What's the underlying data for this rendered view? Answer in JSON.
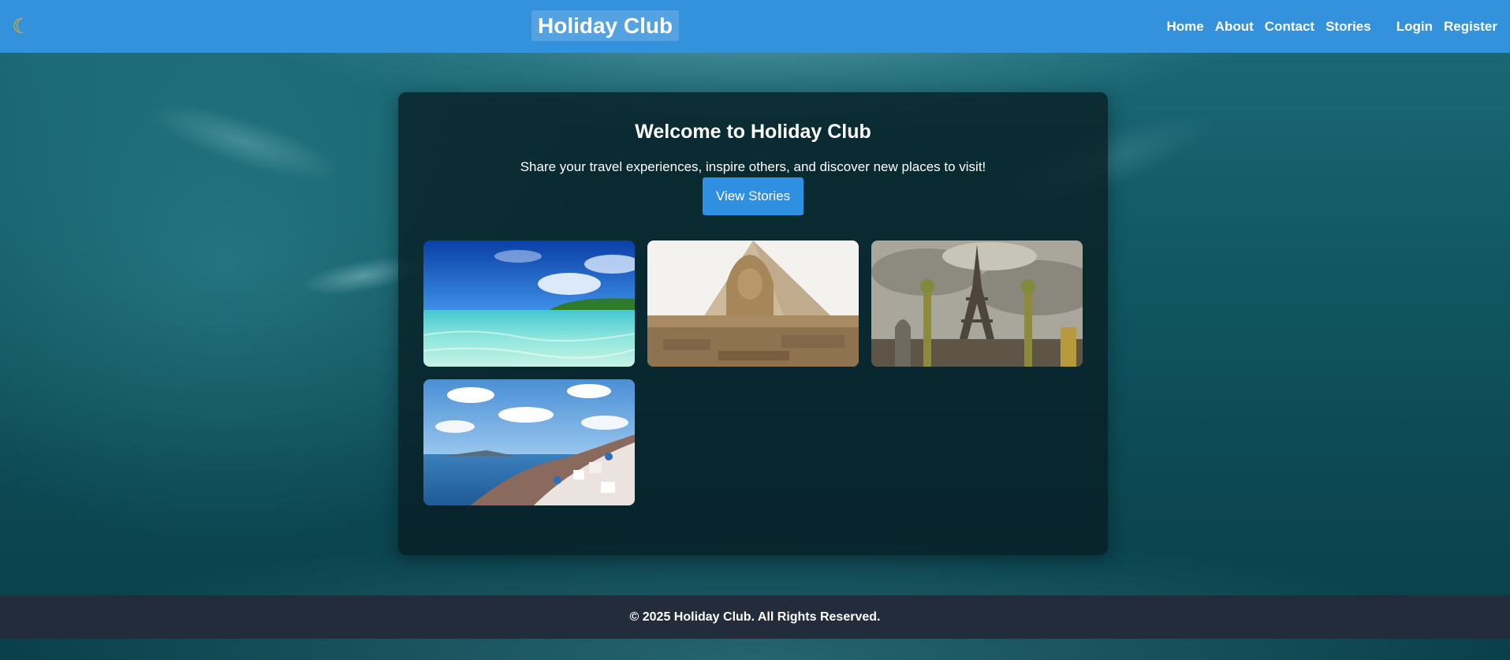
{
  "app": {
    "theme_icon": "moon-icon",
    "brand": "Holiday Club"
  },
  "nav": {
    "home": "Home",
    "about": "About",
    "contact": "Contact",
    "stories": "Stories",
    "login": "Login",
    "register": "Register"
  },
  "hero": {
    "title": "Welcome to Holiday Club",
    "subtitle": "Share your travel experiences, inspire others, and discover new places to visit!",
    "cta": "View Stories"
  },
  "gallery": [
    {
      "subject": "tropical beach"
    },
    {
      "subject": "sphinx and pyramid"
    },
    {
      "subject": "eiffel tower"
    },
    {
      "subject": "santorini coastline"
    }
  ],
  "footer": {
    "text": "© 2025 Holiday Club. All Rights Reserved."
  },
  "colors": {
    "header": "#3491dc",
    "button": "#2f8fe0",
    "footer": "#232c3a",
    "card": "rgba(8, 28, 34, 0.78)"
  }
}
